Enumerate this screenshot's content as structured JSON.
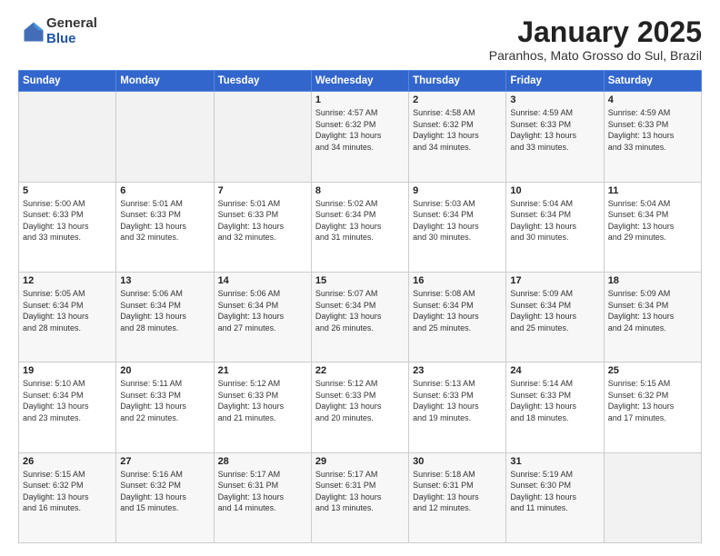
{
  "header": {
    "logo_general": "General",
    "logo_blue": "Blue",
    "month": "January 2025",
    "location": "Paranhos, Mato Grosso do Sul, Brazil"
  },
  "weekdays": [
    "Sunday",
    "Monday",
    "Tuesday",
    "Wednesday",
    "Thursday",
    "Friday",
    "Saturday"
  ],
  "weeks": [
    [
      {
        "day": "",
        "info": ""
      },
      {
        "day": "",
        "info": ""
      },
      {
        "day": "",
        "info": ""
      },
      {
        "day": "1",
        "info": "Sunrise: 4:57 AM\nSunset: 6:32 PM\nDaylight: 13 hours\nand 34 minutes."
      },
      {
        "day": "2",
        "info": "Sunrise: 4:58 AM\nSunset: 6:32 PM\nDaylight: 13 hours\nand 34 minutes."
      },
      {
        "day": "3",
        "info": "Sunrise: 4:59 AM\nSunset: 6:33 PM\nDaylight: 13 hours\nand 33 minutes."
      },
      {
        "day": "4",
        "info": "Sunrise: 4:59 AM\nSunset: 6:33 PM\nDaylight: 13 hours\nand 33 minutes."
      }
    ],
    [
      {
        "day": "5",
        "info": "Sunrise: 5:00 AM\nSunset: 6:33 PM\nDaylight: 13 hours\nand 33 minutes."
      },
      {
        "day": "6",
        "info": "Sunrise: 5:01 AM\nSunset: 6:33 PM\nDaylight: 13 hours\nand 32 minutes."
      },
      {
        "day": "7",
        "info": "Sunrise: 5:01 AM\nSunset: 6:33 PM\nDaylight: 13 hours\nand 32 minutes."
      },
      {
        "day": "8",
        "info": "Sunrise: 5:02 AM\nSunset: 6:34 PM\nDaylight: 13 hours\nand 31 minutes."
      },
      {
        "day": "9",
        "info": "Sunrise: 5:03 AM\nSunset: 6:34 PM\nDaylight: 13 hours\nand 30 minutes."
      },
      {
        "day": "10",
        "info": "Sunrise: 5:04 AM\nSunset: 6:34 PM\nDaylight: 13 hours\nand 30 minutes."
      },
      {
        "day": "11",
        "info": "Sunrise: 5:04 AM\nSunset: 6:34 PM\nDaylight: 13 hours\nand 29 minutes."
      }
    ],
    [
      {
        "day": "12",
        "info": "Sunrise: 5:05 AM\nSunset: 6:34 PM\nDaylight: 13 hours\nand 28 minutes."
      },
      {
        "day": "13",
        "info": "Sunrise: 5:06 AM\nSunset: 6:34 PM\nDaylight: 13 hours\nand 28 minutes."
      },
      {
        "day": "14",
        "info": "Sunrise: 5:06 AM\nSunset: 6:34 PM\nDaylight: 13 hours\nand 27 minutes."
      },
      {
        "day": "15",
        "info": "Sunrise: 5:07 AM\nSunset: 6:34 PM\nDaylight: 13 hours\nand 26 minutes."
      },
      {
        "day": "16",
        "info": "Sunrise: 5:08 AM\nSunset: 6:34 PM\nDaylight: 13 hours\nand 25 minutes."
      },
      {
        "day": "17",
        "info": "Sunrise: 5:09 AM\nSunset: 6:34 PM\nDaylight: 13 hours\nand 25 minutes."
      },
      {
        "day": "18",
        "info": "Sunrise: 5:09 AM\nSunset: 6:34 PM\nDaylight: 13 hours\nand 24 minutes."
      }
    ],
    [
      {
        "day": "19",
        "info": "Sunrise: 5:10 AM\nSunset: 6:34 PM\nDaylight: 13 hours\nand 23 minutes."
      },
      {
        "day": "20",
        "info": "Sunrise: 5:11 AM\nSunset: 6:33 PM\nDaylight: 13 hours\nand 22 minutes."
      },
      {
        "day": "21",
        "info": "Sunrise: 5:12 AM\nSunset: 6:33 PM\nDaylight: 13 hours\nand 21 minutes."
      },
      {
        "day": "22",
        "info": "Sunrise: 5:12 AM\nSunset: 6:33 PM\nDaylight: 13 hours\nand 20 minutes."
      },
      {
        "day": "23",
        "info": "Sunrise: 5:13 AM\nSunset: 6:33 PM\nDaylight: 13 hours\nand 19 minutes."
      },
      {
        "day": "24",
        "info": "Sunrise: 5:14 AM\nSunset: 6:33 PM\nDaylight: 13 hours\nand 18 minutes."
      },
      {
        "day": "25",
        "info": "Sunrise: 5:15 AM\nSunset: 6:32 PM\nDaylight: 13 hours\nand 17 minutes."
      }
    ],
    [
      {
        "day": "26",
        "info": "Sunrise: 5:15 AM\nSunset: 6:32 PM\nDaylight: 13 hours\nand 16 minutes."
      },
      {
        "day": "27",
        "info": "Sunrise: 5:16 AM\nSunset: 6:32 PM\nDaylight: 13 hours\nand 15 minutes."
      },
      {
        "day": "28",
        "info": "Sunrise: 5:17 AM\nSunset: 6:31 PM\nDaylight: 13 hours\nand 14 minutes."
      },
      {
        "day": "29",
        "info": "Sunrise: 5:17 AM\nSunset: 6:31 PM\nDaylight: 13 hours\nand 13 minutes."
      },
      {
        "day": "30",
        "info": "Sunrise: 5:18 AM\nSunset: 6:31 PM\nDaylight: 13 hours\nand 12 minutes."
      },
      {
        "day": "31",
        "info": "Sunrise: 5:19 AM\nSunset: 6:30 PM\nDaylight: 13 hours\nand 11 minutes."
      },
      {
        "day": "",
        "info": ""
      }
    ]
  ]
}
